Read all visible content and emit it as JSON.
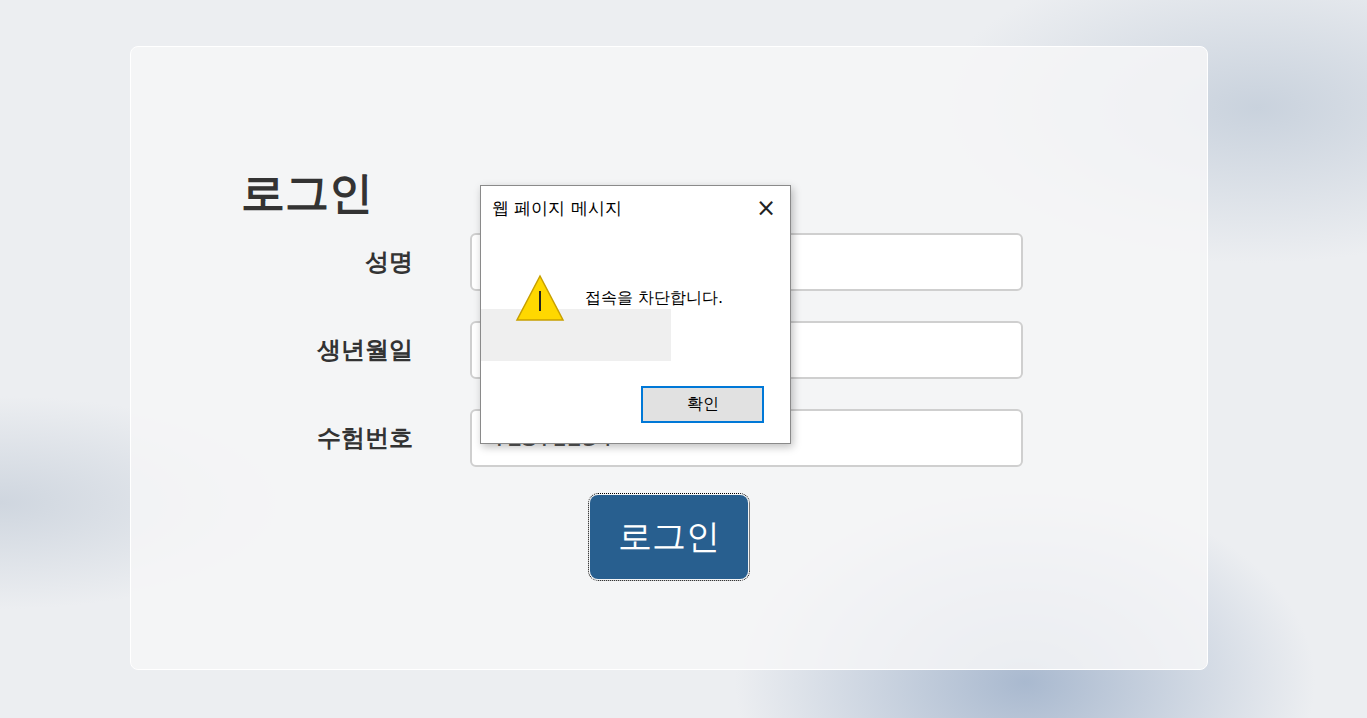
{
  "page": {
    "title": "로그인"
  },
  "fields": [
    {
      "label": "성명",
      "value": ""
    },
    {
      "label": "생년월일",
      "value": ""
    },
    {
      "label": "수험번호",
      "value": "TEST1234"
    }
  ],
  "login_button": {
    "label": "로그인",
    "focused": true
  },
  "dialog": {
    "title": "웹 페이지 메시지",
    "close": "×",
    "message": "접속을 차단합니다.",
    "buttons": [
      "확인"
    ]
  }
}
